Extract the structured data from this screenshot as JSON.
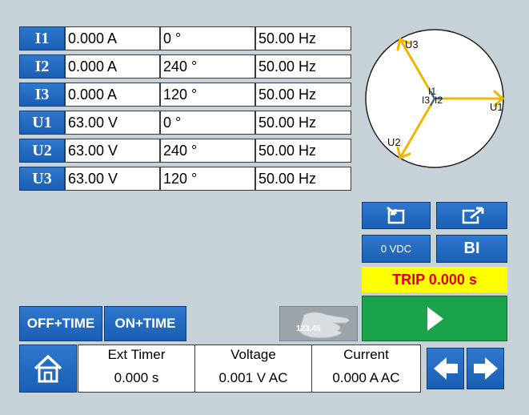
{
  "channels": [
    {
      "name": "I1",
      "magnitude": "0.000 A",
      "angle": "0 °",
      "frequency": "50.00 Hz"
    },
    {
      "name": "I2",
      "magnitude": "0.000 A",
      "angle": "240 °",
      "frequency": "50.00 Hz"
    },
    {
      "name": "I3",
      "magnitude": "0.000 A",
      "angle": "120 °",
      "frequency": "50.00 Hz"
    },
    {
      "name": "U1",
      "magnitude": "63.00 V",
      "angle": "0 °",
      "frequency": "50.00 Hz"
    },
    {
      "name": "U2",
      "magnitude": "63.00 V",
      "angle": "240 °",
      "frequency": "50.00 Hz"
    },
    {
      "name": "U3",
      "magnitude": "63.00 V",
      "angle": "120 °",
      "frequency": "50.00 Hz"
    }
  ],
  "phasor": {
    "labels": {
      "u1": "U1",
      "u2": "U2",
      "u3": "U3",
      "i1": "I1",
      "i2": "I2",
      "i3": "I3"
    },
    "vector_color": "#f2b600"
  },
  "controls": {
    "dc_label": "0 VDC",
    "bi_label": "BI",
    "trip_text": "TRIP 0.000 s",
    "off_time_label": "OFF+TIME",
    "on_time_label": "ON+TIME",
    "manual_value": "123.45"
  },
  "status": {
    "ext_timer": {
      "label": "Ext Timer",
      "value": "0.000 s"
    },
    "voltage": {
      "label": "Voltage",
      "value": "0.001 V AC"
    },
    "current": {
      "label": "Current",
      "value": "0.000 A AC"
    }
  },
  "colors": {
    "accent": "#1f66bf",
    "background": "#c7d2d8",
    "trip_bg": "#ffff00",
    "trip_text": "#e00000",
    "play": "#1aa34a"
  }
}
